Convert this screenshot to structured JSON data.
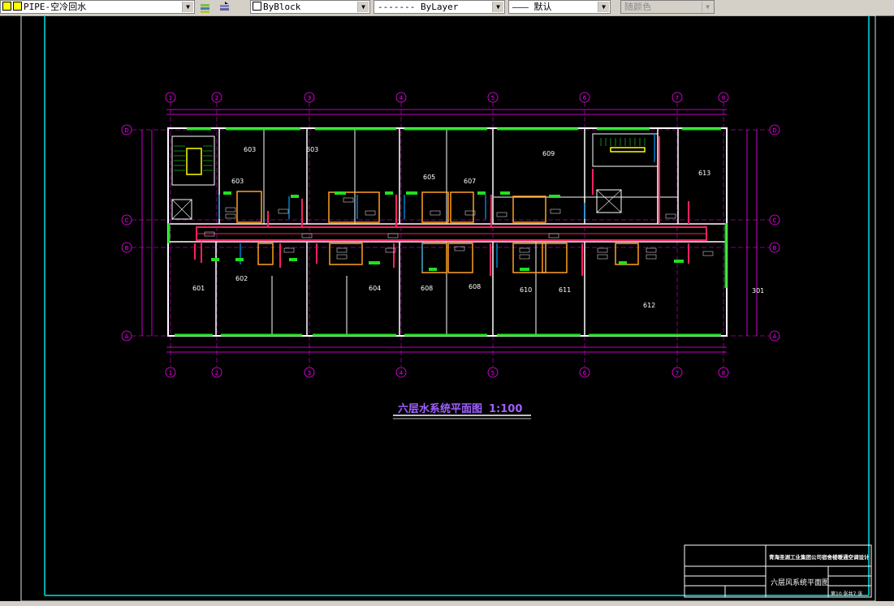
{
  "toolbar": {
    "layer_name": "PIPE-空冷回水",
    "color_value": "ByBlock",
    "linetype_value": "------- ByLayer",
    "lineweight_value": "——— 默认",
    "plotstyle_value": "随颜色"
  },
  "drawing": {
    "title": "六层水系统平面图",
    "scale": "1:100",
    "grid_columns": [
      "1",
      "2",
      "3",
      "4",
      "5",
      "6",
      "7",
      "8"
    ],
    "grid_rows": [
      "D",
      "C",
      "B",
      "A"
    ],
    "rooms": [
      {
        "label": "603"
      },
      {
        "label": "603"
      },
      {
        "label": "603"
      },
      {
        "label": "605"
      },
      {
        "label": "607"
      },
      {
        "label": "609"
      },
      {
        "label": "613"
      },
      {
        "label": "601"
      },
      {
        "label": "602"
      },
      {
        "label": "604"
      },
      {
        "label": "608"
      },
      {
        "label": "608"
      },
      {
        "label": "610"
      },
      {
        "label": "611"
      },
      {
        "label": "612"
      },
      {
        "label": "301"
      }
    ]
  },
  "title_block": {
    "company": "青海圣湖工业集团公司宿舍楼暖通空调设计",
    "sheet_title": "六层风系统平面图",
    "sheet_no": "第10 张共7 张"
  },
  "colors": {
    "background": "#000000",
    "wall": "#ffffff",
    "supply_pipe": "#ff2060",
    "return_pipe": "#00a0ff",
    "window": "#20e020",
    "fan_coil": "#ffa020",
    "axis": "#ff00ff",
    "border": "#00e0e0",
    "title_text": "#a060ff"
  }
}
